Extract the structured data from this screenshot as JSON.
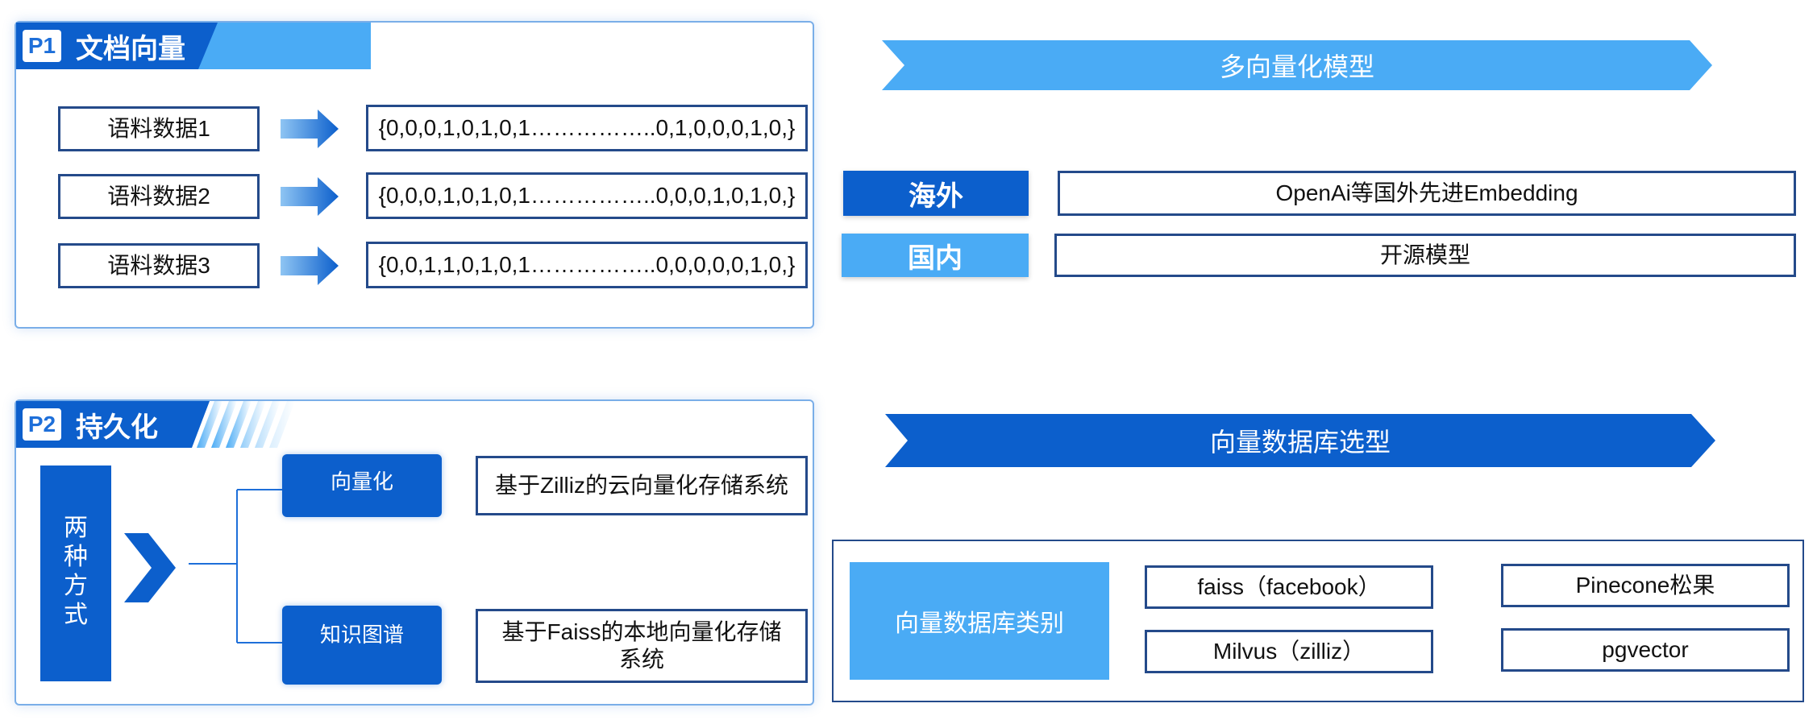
{
  "p1": {
    "badge": "P1",
    "title": "文档向量",
    "rows": [
      {
        "label": "语料数据1",
        "vector": "{0,0,0,1,0,1,0,1……………..0,1,0,0,0,1,0,}"
      },
      {
        "label": "语料数据2",
        "vector": "{0,0,0,1,0,1,0,1……………..0,0,0,1,0,1,0,}"
      },
      {
        "label": "语料数据3",
        "vector": "{0,0,1,1,0,1,0,1……………..0,0,0,0,0,1,0,}"
      }
    ]
  },
  "p2": {
    "badge": "P2",
    "title": "持久化",
    "side_label": "两种方式",
    "branches": [
      {
        "label": "向量化",
        "desc": "基于Zilliz的云向量化存储系统"
      },
      {
        "label": "知识图谱",
        "desc": "基于Faiss的本地向量化存储系统"
      }
    ]
  },
  "multi_model": {
    "banner": "多向量化模型",
    "rows": [
      {
        "tag": "海外",
        "text": "OpenAi等国外先进Embedding"
      },
      {
        "tag": "国内",
        "text": "开源模型"
      }
    ]
  },
  "vector_db": {
    "banner": "向量数据库选型",
    "category_label": "向量数据库类别",
    "items": [
      "faiss（facebook）",
      "Pinecone松果",
      "Milvus（zilliz）",
      "pgvector"
    ]
  },
  "colors": {
    "dark_blue": "#0c5fcc",
    "light_blue": "#4aabf5",
    "border_navy": "#244a8a"
  }
}
